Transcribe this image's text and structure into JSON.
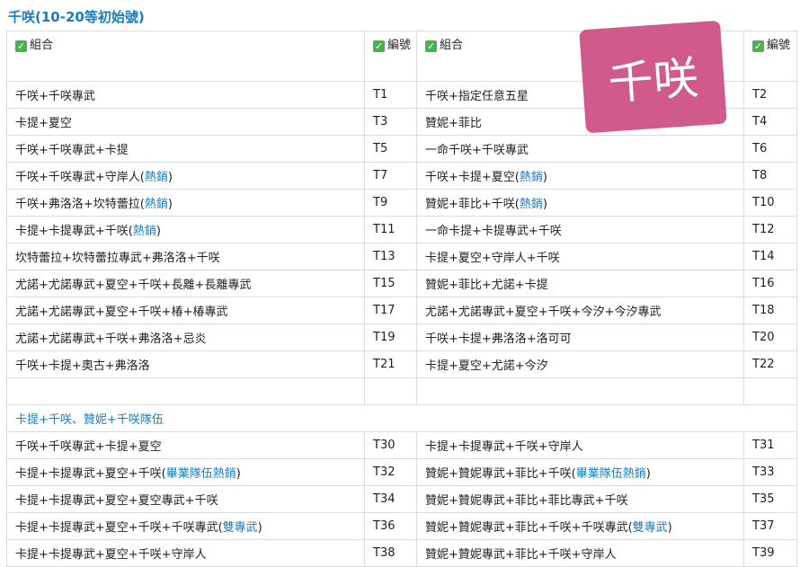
{
  "title": "千咲(10-20等初始號)",
  "header": {
    "combo": "組合",
    "code": "編號"
  },
  "stamp": "千咲",
  "rows_a": [
    {
      "l": "千咲+千咲專武",
      "lc": "T1",
      "r": "千咲+指定任意五星",
      "rc": "T2"
    },
    {
      "l": "卡提+夏空",
      "lc": "T3",
      "r": "贊妮+菲比",
      "rc": "T4"
    },
    {
      "l": "千咲+千咲專武+卡提",
      "lc": "T5",
      "r": "一命千咲+千咲專武",
      "rc": "T6"
    },
    {
      "l": "千咲+千咲專武+守岸人(",
      "lh": "熱銷",
      "ls": ")",
      "lc": "T7",
      "r": "千咲+卡提+夏空(",
      "rh": "熱銷",
      "rs": ")",
      "rc": "T8"
    },
    {
      "l": "千咲+弗洛洛+坎特蕾拉(",
      "lh": "熱銷",
      "ls": ")",
      "lc": "T9",
      "r": "贊妮+菲比+千咲(",
      "rh": "熱銷",
      "rs": ")",
      "rc": "T10"
    },
    {
      "l": "卡提+卡提專武+千咲(",
      "lh": "熱銷",
      "ls": ")",
      "lc": "T11",
      "r": "一命卡提+卡提專武+千咲",
      "rc": "T12"
    },
    {
      "l": "坎特蕾拉+坎特蕾拉專武+弗洛洛+千咲",
      "lc": "T13",
      "r": "卡提+夏空+守岸人+千咲",
      "rc": "T14"
    },
    {
      "l": "尤諾+尤諾專武+夏空+千咲+長離+長離專武",
      "lc": "T15",
      "r": "贊妮+菲比+尤諾+卡提",
      "rc": "T16"
    },
    {
      "l": "尤諾+尤諾專武+夏空+千咲+椿+椿專武",
      "lc": "T17",
      "r": "尤諾+尤諾專武+夏空+千咲+今汐+今汐專武",
      "rc": "T18"
    },
    {
      "l": "尤諾+尤諾專武+千咲+弗洛洛+忌炎",
      "lc": "T19",
      "r": "千咲+卡提+弗洛洛+洛可可",
      "rc": "T20"
    },
    {
      "l": "千咲+卡提+奧古+弗洛洛",
      "lc": "T21",
      "r": "卡提+夏空+尤諾+今汐",
      "rc": "T22"
    }
  ],
  "section": "卡提+千咲、贊妮+千咲隊伍",
  "rows_b": [
    {
      "l": "千咲+千咲專武+卡提+夏空",
      "lc": "T30",
      "r": "卡提+卡提專武+千咲+守岸人",
      "rc": "T31"
    },
    {
      "l": "卡提+卡提專武+夏空+千咲(",
      "lh": "畢業隊伍熱銷",
      "ls": ")",
      "lc": "T32",
      "r": "贊妮+贊妮專武+菲比+千咲(",
      "rh": "畢業隊伍熱銷",
      "rs": ")",
      "rc": "T33"
    },
    {
      "l": "卡提+卡提專武+夏空+夏空專武+千咲",
      "lc": "T34",
      "r": "贊妮+贊妮專武+菲比+菲比專武+千咲",
      "rc": "T35"
    },
    {
      "l": "卡提+卡提專武+夏空+千咲+千咲專武(",
      "lh": "雙專武",
      "ls": ")",
      "lc": "T36",
      "r": "贊妮+贊妮專武+菲比+千咲+千咲專武(",
      "rh": "雙專武",
      "rs": ")",
      "rc": "T37"
    },
    {
      "l": "卡提+卡提專武+夏空+千咲+守岸人",
      "lc": "T38",
      "r": "贊妮+贊妮專武+菲比+千咲+守岸人",
      "rc": "T39"
    }
  ]
}
